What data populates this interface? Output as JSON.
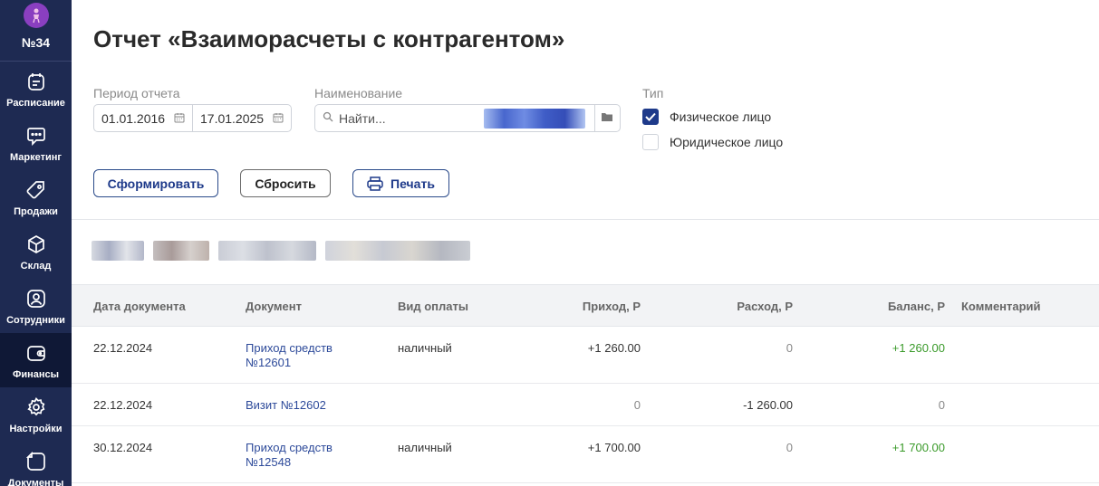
{
  "sidebar": {
    "branch": {
      "label": "№34"
    },
    "items": [
      {
        "label": "Расписание",
        "icon": "calendar-icon"
      },
      {
        "label": "Маркетинг",
        "icon": "chat-bubble-icon"
      },
      {
        "label": "Продажи",
        "icon": "tag-icon"
      },
      {
        "label": "Склад",
        "icon": "box-icon"
      },
      {
        "label": "Сотрудники",
        "icon": "person-icon"
      },
      {
        "label": "Финансы",
        "icon": "wallet-icon",
        "active": true
      },
      {
        "label": "Настройки",
        "icon": "gear-icon"
      },
      {
        "label": "Документы",
        "icon": "document-icon"
      }
    ]
  },
  "page": {
    "title": "Отчет «Взаиморасчеты с контрагентом»"
  },
  "filters": {
    "period_label": "Период отчета",
    "date_from": "01.01.2016",
    "date_to": "17.01.2025",
    "name_label": "Наименование",
    "search_placeholder": "Найти...",
    "type_label": "Тип",
    "type_options": [
      {
        "label": "Физическое лицо",
        "checked": true
      },
      {
        "label": "Юридическое лицо",
        "checked": false
      }
    ]
  },
  "actions": {
    "generate": "Сформировать",
    "reset": "Сбросить",
    "print": "Печать"
  },
  "table": {
    "headers": [
      "Дата документа",
      "Документ",
      "Вид оплаты",
      "Приход, Р",
      "Расход, Р",
      "Баланс, Р",
      "Комментарий"
    ],
    "rows": [
      {
        "date": "22.12.2024",
        "doc_line1": "Приход средств",
        "doc_line2": "№12601",
        "payment": "наличный",
        "income": "+1 260.00",
        "expense": "0",
        "balance": "+1 260.00"
      },
      {
        "date": "22.12.2024",
        "doc_line1": "Визит №12602",
        "doc_line2": "",
        "payment": "",
        "income": "0",
        "expense": "-1 260.00",
        "balance": "0"
      },
      {
        "date": "30.12.2024",
        "doc_line1": "Приход средств",
        "doc_line2": "№12548",
        "payment": "наличный",
        "income": "+1 700.00",
        "expense": "0",
        "balance": "+1 700.00"
      }
    ]
  },
  "colors": {
    "sidebar_bg": "#1e2a52",
    "sidebar_active": "#0f1836",
    "accent": "#1e3a8a",
    "positive": "#3a9a2a",
    "link": "#2d4a9a"
  }
}
